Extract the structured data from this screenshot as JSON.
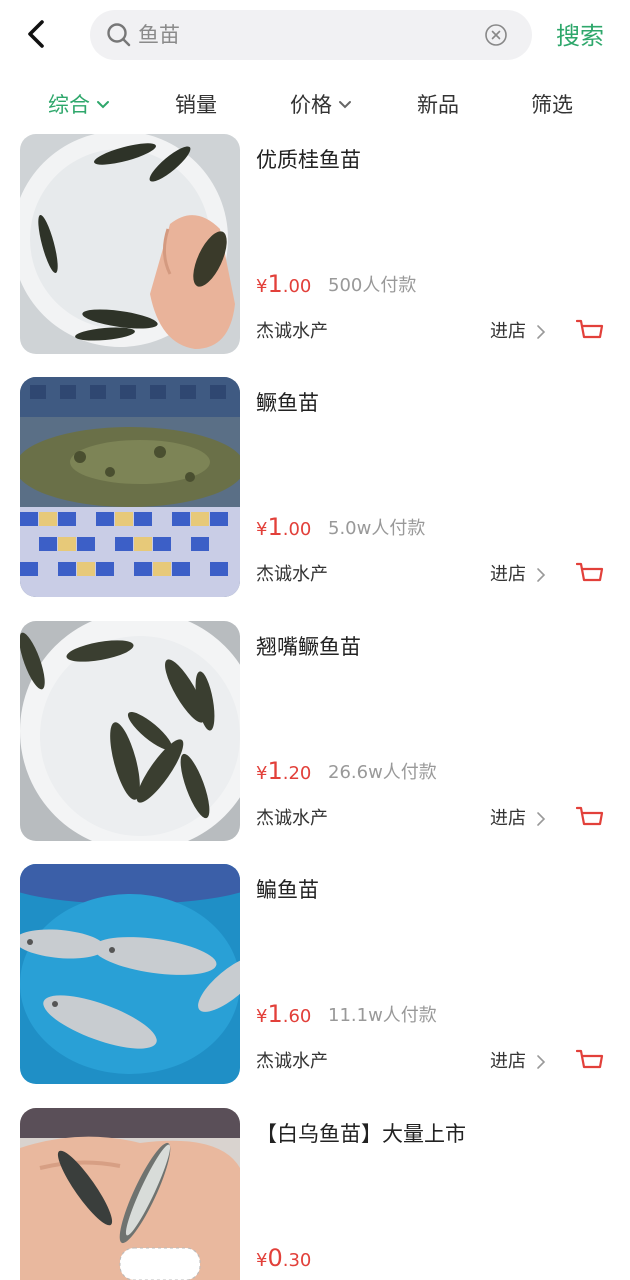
{
  "header": {
    "back_icon": "chevron-left-icon",
    "search_query": "鱼苗",
    "search_icon": "search-icon",
    "clear_icon": "clear-circle-icon",
    "search_button": "搜索",
    "accent": "#2ea76b"
  },
  "sort": {
    "tabs": [
      {
        "label": "综合",
        "active": true,
        "has_chevron": true
      },
      {
        "label": "销量",
        "active": false,
        "has_chevron": false
      },
      {
        "label": "价格",
        "active": false,
        "has_chevron": true
      },
      {
        "label": "新品",
        "active": false,
        "has_chevron": false
      },
      {
        "label": "筛选",
        "active": false,
        "has_chevron": false
      }
    ]
  },
  "products": [
    {
      "title": "优质桂鱼苗",
      "price_symbol": "¥",
      "price_int": "1",
      "price_dec": ".00",
      "sales": "500人付款",
      "shop": "杰诚水产",
      "enter": "进店"
    },
    {
      "title": "鳜鱼苗",
      "price_symbol": "¥",
      "price_int": "1",
      "price_dec": ".00",
      "sales": "5.0w人付款",
      "shop": "杰诚水产",
      "enter": "进店"
    },
    {
      "title": "翘嘴鳜鱼苗",
      "price_symbol": "¥",
      "price_int": "1",
      "price_dec": ".20",
      "sales": "26.6w人付款",
      "shop": "杰诚水产",
      "enter": "进店"
    },
    {
      "title": "鳊鱼苗",
      "price_symbol": "¥",
      "price_int": "1",
      "price_dec": ".60",
      "sales": "11.1w人付款",
      "shop": "杰诚水产",
      "enter": "进店"
    },
    {
      "title": "【白乌鱼苗】大量上市",
      "price_symbol": "¥",
      "price_int": "0",
      "price_dec": ".30",
      "sales": "",
      "shop": "",
      "enter": ""
    }
  ],
  "colors": {
    "price": "#e2403a",
    "muted": "#999999",
    "cart": "#e2403a"
  }
}
